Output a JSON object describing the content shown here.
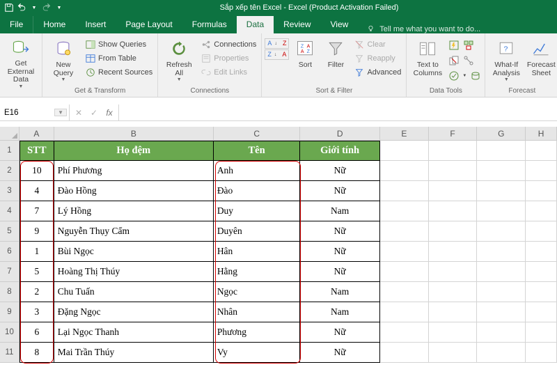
{
  "titlebar": {
    "title": "Sắp xếp tên Excel - Excel (Product Activation Failed)"
  },
  "tabs": {
    "file": "File",
    "home": "Home",
    "insert": "Insert",
    "pagelayout": "Page Layout",
    "formulas": "Formulas",
    "data": "Data",
    "review": "Review",
    "view": "View",
    "tellme": "Tell me what you want to do..."
  },
  "ribbon": {
    "get_external": "Get External\nData",
    "new_query": "New\nQuery",
    "show_queries": "Show Queries",
    "from_table": "From Table",
    "recent_sources": "Recent Sources",
    "group_get_transform": "Get & Transform",
    "refresh_all": "Refresh\nAll",
    "connections": "Connections",
    "properties": "Properties",
    "edit_links": "Edit Links",
    "group_connections": "Connections",
    "sort": "Sort",
    "filter": "Filter",
    "clear": "Clear",
    "reapply": "Reapply",
    "advanced": "Advanced",
    "group_sort_filter": "Sort & Filter",
    "text_cols": "Text to\nColumns",
    "group_data_tools": "Data Tools",
    "whatif": "What-If\nAnalysis",
    "forecast_sheet": "Forecast\nSheet",
    "group_forecast": "Forecast"
  },
  "namebox": {
    "ref": "E16"
  },
  "columns": [
    "A",
    "B",
    "C",
    "D",
    "E",
    "F",
    "G",
    "H"
  ],
  "headers": {
    "stt": "STT",
    "hodem": "Họ đệm",
    "ten": "Tên",
    "gt": "Giới tính"
  },
  "data_rows": [
    {
      "stt": "10",
      "hodem": "Phí Phương",
      "ten": "Anh",
      "gt": "Nữ"
    },
    {
      "stt": "4",
      "hodem": "Đào Hồng",
      "ten": "Đào",
      "gt": "Nữ"
    },
    {
      "stt": "7",
      "hodem": "Lý Hồng",
      "ten": "Duy",
      "gt": "Nam"
    },
    {
      "stt": "9",
      "hodem": "Nguyễn Thụy Cẩm",
      "ten": "Duyên",
      "gt": "Nữ"
    },
    {
      "stt": "1",
      "hodem": "Bùi Ngọc",
      "ten": "Hân",
      "gt": "Nữ"
    },
    {
      "stt": "5",
      "hodem": "Hoàng Thị Thúy",
      "ten": "Hằng",
      "gt": "Nữ"
    },
    {
      "stt": "2",
      "hodem": "Chu Tuấn",
      "ten": "Ngọc",
      "gt": "Nam"
    },
    {
      "stt": "3",
      "hodem": "Đặng Ngọc",
      "ten": "Nhân",
      "gt": "Nam"
    },
    {
      "stt": "6",
      "hodem": "Lại Ngọc Thanh",
      "ten": "Phương",
      "gt": "Nữ"
    },
    {
      "stt": "8",
      "hodem": "Mai Trần Thúy",
      "ten": "Vy",
      "gt": "Nữ"
    }
  ],
  "colwidths": {
    "A": 50,
    "B": 230,
    "C": 125,
    "D": 115,
    "E": 70,
    "F": 70,
    "G": 70,
    "H": 45
  }
}
